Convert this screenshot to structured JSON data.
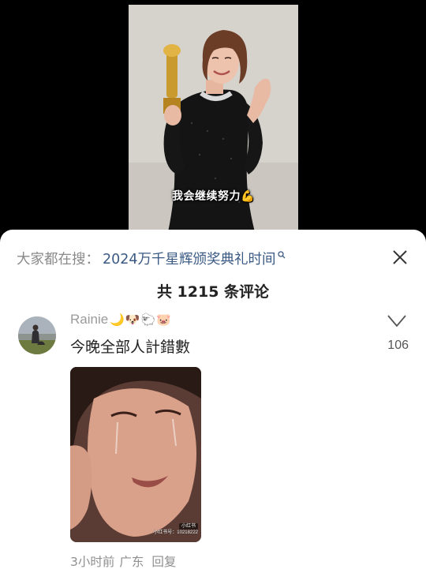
{
  "video": {
    "caption": "我会继续努力",
    "caption_emoji": "💪"
  },
  "search_suggestion": {
    "prefix": "大家都在搜：",
    "term": "2024万千星辉颁奖典礼时间",
    "icon": "search-icon"
  },
  "comments_header": {
    "title": "共 1215 条评论",
    "close_icon": "close-icon"
  },
  "comment": {
    "username": "Rainie",
    "username_emojis": "🌙🐶🐑🐷",
    "text": "今晚全部人計錯數",
    "like_count": "106",
    "like_icon": "heart-outline-icon",
    "image_watermark": {
      "badge": "小红书",
      "id": "小红书号：10218222"
    },
    "time": "3小时前",
    "location": "广东",
    "reply_label": "回复"
  },
  "colors": {
    "link": "#3a5a84",
    "muted": "#8a8a8a",
    "text": "#222222",
    "sheet_bg": "#ffffff",
    "page_bg": "#000000"
  }
}
